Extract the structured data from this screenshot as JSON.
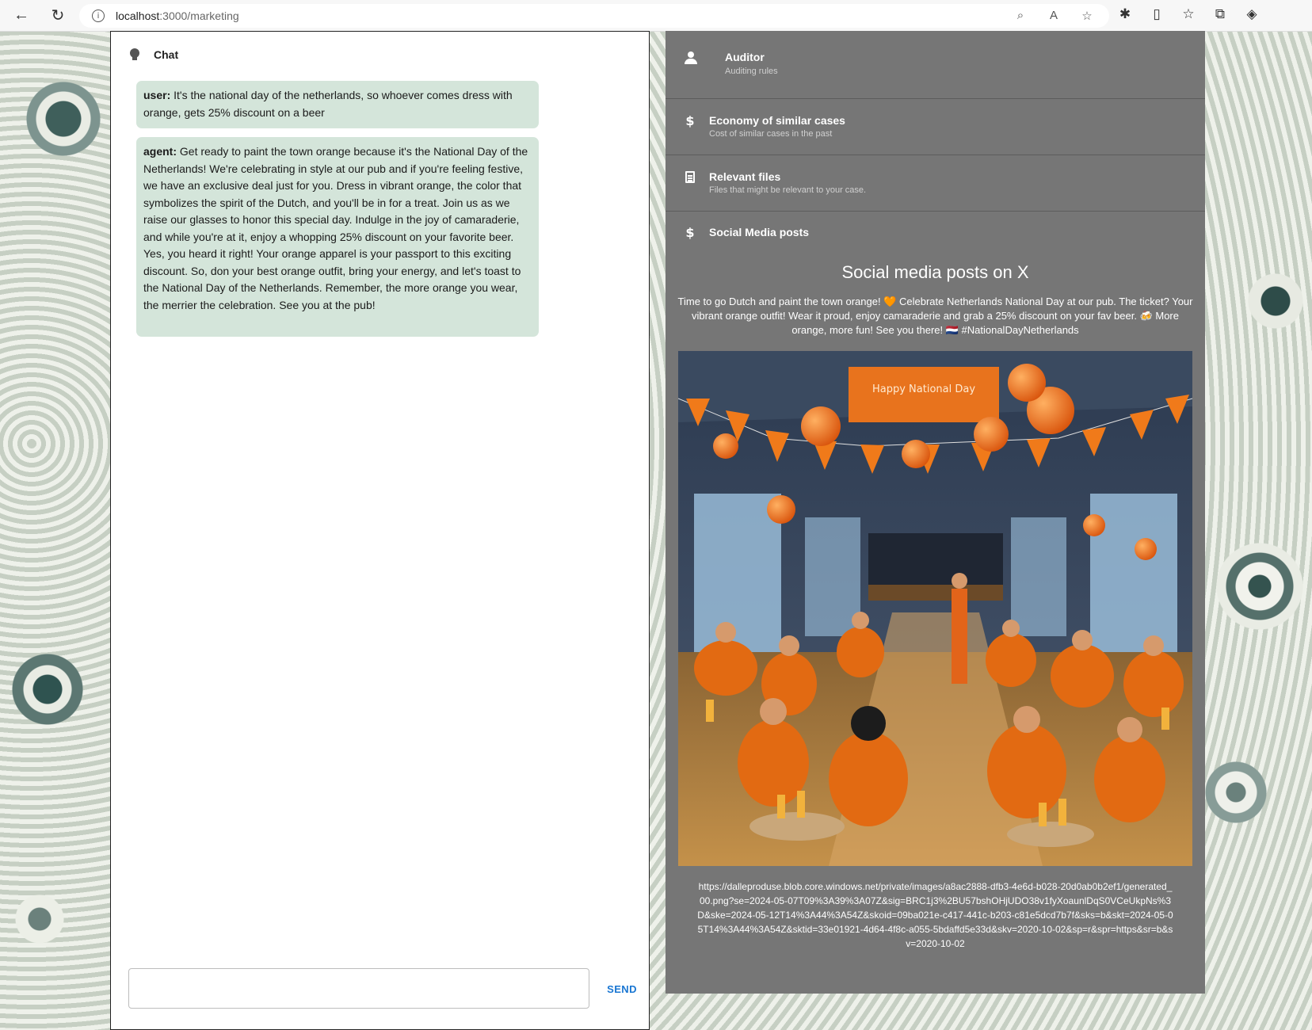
{
  "browser": {
    "url_host": "localhost",
    "url_path": ":3000/marketing"
  },
  "chat": {
    "title": "Chat",
    "messages": [
      {
        "role": "user:",
        "text": " It's the national day of the netherlands, so whoever comes dress with orange, gets 25% discount on a beer"
      },
      {
        "role": "agent:",
        "text": " Get ready to paint the town orange because it's the National Day of the Netherlands! We're celebrating in style at our pub and if you're feeling festive, we have an exclusive deal just for you. Dress in vibrant orange, the color that symbolizes the spirit of the Dutch, and you'll be in for a treat. Join us as we raise our glasses to honor this special day. Indulge in the joy of camaraderie, and while you're at it, enjoy a whopping 25% discount on your favorite beer. Yes, you heard it right! Your orange apparel is your passport to this exciting discount. So, don your best orange outfit, bring your energy, and let's toast to the National Day of the Netherlands. Remember, the more orange you wear, the merrier the celebration. See you at the pub!"
      }
    ],
    "input_value": "",
    "send_label": "SEND"
  },
  "sidebar": {
    "auditor": {
      "title": "Auditor",
      "subtitle": "Auditing rules"
    },
    "economy": {
      "title": "Economy of similar cases",
      "subtitle": "Cost of similar cases in the past",
      "icon": "$"
    },
    "files": {
      "title": "Relevant files",
      "subtitle": "Files that might be relevant to your case."
    },
    "social": {
      "title": "Social Media posts",
      "icon": "$"
    }
  },
  "social": {
    "heading": "Social media posts on X",
    "post": "Time to go Dutch and paint the town orange! 🧡 Celebrate Netherlands National Day at our pub. The ticket? Your vibrant orange outfit! Wear it proud, enjoy camaraderie and grab a 25% discount on your fav beer. 🍻 More orange, more fun! See you there! 🇳🇱 #NationalDayNetherlands",
    "banner_text": "Happy National Day",
    "url": "https://dalleproduse.blob.core.windows.net/private/images/a8ac2888-dfb3-4e6d-b028-20d0ab0b2ef1/generated_00.png?se=2024-05-07T09%3A39%3A07Z&sig=BRC1j3%2BU57bshOHjUDO38v1fyXoaunlDqS0VCeUkpNs%3D&ske=2024-05-12T14%3A44%3A54Z&skoid=09ba021e-c417-441c-b203-c81e5dcd7b7f&sks=b&skt=2024-05-05T14%3A44%3A54Z&sktid=33e01921-4d64-4f8c-a055-5bdaffd5e33d&skv=2020-10-02&sp=r&spr=https&sr=b&sv=2020-10-02"
  },
  "colors": {
    "message_bg": "#d4e5da",
    "panel_gray": "#767676",
    "send_blue": "#1976d2"
  }
}
